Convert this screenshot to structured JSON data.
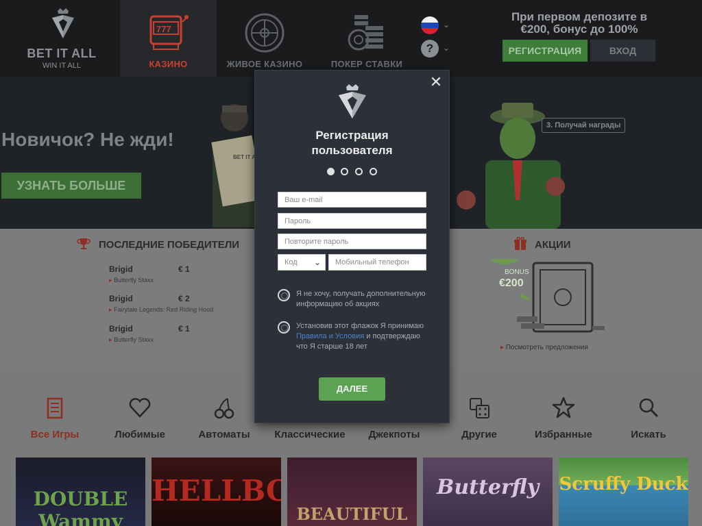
{
  "header": {
    "logo_title": "BET IT ALL",
    "logo_subtitle": "WIN IT ALL",
    "nav": [
      {
        "label": "КАЗИНО",
        "icon": "slot-machine-icon"
      },
      {
        "label": "ЖИВОЕ КАЗИНО",
        "icon": "roulette-icon"
      },
      {
        "label": "ПОКЕР СТАВКИ",
        "icon": "poker-chips-icon"
      }
    ],
    "promo_text": "При первом депозите в €200, бонус до 100%",
    "register_label": "РЕГИСТРАЦИЯ",
    "login_label": "ВХОД"
  },
  "hero": {
    "title": "Новичок? Не жди!",
    "cta_label": "УЗНАТЬ БОЛЬШЕ",
    "step_label": "3. Получай награды",
    "sign_text": "BET IT ALL"
  },
  "winners": {
    "heading": "ПОСЛЕДНИЕ ПОБЕДИТЕЛИ",
    "items": [
      {
        "name": "Brigid",
        "amount": "€ 1",
        "game": "Butterfly Staxx"
      },
      {
        "name": "Brigid",
        "amount": "€ 2",
        "game": "Fairytale Legends: Red Riding Hood"
      },
      {
        "name": "Brigid",
        "amount": "€ 1",
        "game": "Butterfly Staxx"
      }
    ]
  },
  "promotions": {
    "heading": "АКЦИИ",
    "bonus_label": "BONUS",
    "bonus_value": "€200",
    "link_label": "Посмотреть предложения"
  },
  "categories": [
    {
      "label": "Все Игры",
      "icon": "all-games-icon",
      "active": true
    },
    {
      "label": "Любимые",
      "icon": "heart-icon"
    },
    {
      "label": "Автоматы",
      "icon": "cherries-icon"
    },
    {
      "label": "Классические",
      "icon": "classic-icon"
    },
    {
      "label": "Джекпоты",
      "icon": "jackpot-icon"
    },
    {
      "label": "Другие",
      "icon": "dice-icon"
    },
    {
      "label": "Избранные",
      "icon": "star-icon"
    },
    {
      "label": "Искать",
      "icon": "search-icon"
    }
  ],
  "games": [
    {
      "title": "DOUBLE Wammy"
    },
    {
      "title": "HELLBOY"
    },
    {
      "title": "BEAUTIFUL"
    },
    {
      "title": "Butterfly"
    },
    {
      "title": "Scruffy Duck"
    }
  ],
  "modal": {
    "title_line1": "Регистрация",
    "title_line2": "пользователя",
    "step_count": 4,
    "current_step": 1,
    "email_placeholder": "Ваш e-mail",
    "password_placeholder": "Пароль",
    "repeat_password_placeholder": "Повторите пароль",
    "code_placeholder": "Код",
    "phone_placeholder": "Мобильный телефон",
    "opt_out_text": "Я не хочу, получать дополнительную информацию об акциях",
    "terms_prefix": "Установив этот флажок Я принимаю ",
    "terms_link": "Правила и Условия",
    "terms_suffix": " и подтверждаю что Я старше 18 лет",
    "next_label": "ДАЛЕЕ",
    "close_icon": "close-icon"
  },
  "colors": {
    "accent_red": "#c8402f",
    "green_button": "#5ba352",
    "modal_bg": "#2c3038",
    "link_blue": "#4a86c5"
  }
}
